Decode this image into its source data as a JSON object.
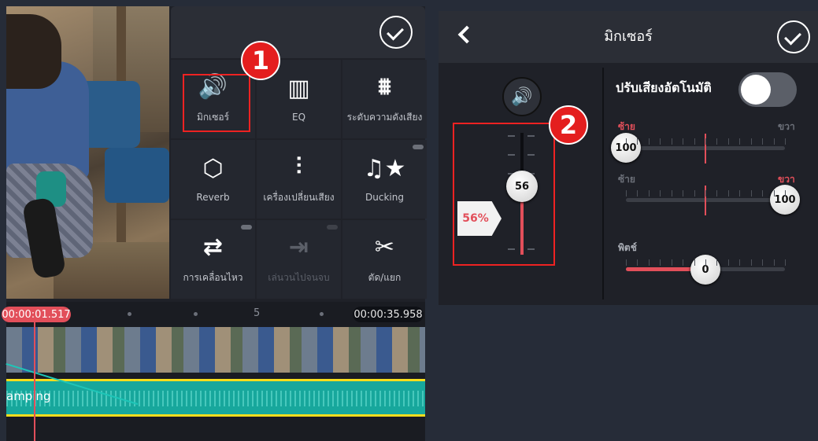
{
  "editor": {
    "tools": [
      {
        "id": "mixer",
        "label": "มิกเซอร์",
        "icon": "speaker-icon",
        "glyph": "🔊"
      },
      {
        "id": "eq",
        "label": "EQ",
        "icon": "equalizer-icon",
        "glyph": "▥"
      },
      {
        "id": "loudness",
        "label": "ระดับความดังเสียง",
        "icon": "loudness-icon",
        "glyph": "⩩"
      },
      {
        "id": "reverb",
        "label": "Reverb",
        "icon": "cube-icon",
        "glyph": "⬡"
      },
      {
        "id": "voice-changer",
        "label": "เครื่องเปลี่ยนเสียง",
        "icon": "waveform-icon",
        "glyph": "⫶"
      },
      {
        "id": "ducking",
        "label": "Ducking",
        "icon": "music-star-icon",
        "glyph": "♫★"
      },
      {
        "id": "motion",
        "label": "การเคลื่อนไหว",
        "icon": "loop-icon",
        "glyph": "⇄"
      },
      {
        "id": "loop",
        "label": "เล่นวนไปจนจบ",
        "icon": "loop-to-end-icon",
        "glyph": "⇥"
      },
      {
        "id": "cut",
        "label": "ตัด/แยก",
        "icon": "scissors-icon",
        "glyph": "✂"
      }
    ],
    "badge1": "1",
    "timeline": {
      "current_time": "00:00:01.517",
      "total_time": "00:00:35.958",
      "marker": "5",
      "audio_label": "amping"
    }
  },
  "mixer": {
    "title": "มิกเซอร์",
    "badge2": "2",
    "volume": {
      "percent_label": "56%",
      "value": 56,
      "fraction": 0.56
    },
    "auto_volume_label": "ปรับเสียงอัตโนมัติ",
    "auto_volume_on": false,
    "pan_left": {
      "left_label": "ซ้าย",
      "right_label": "ขวา",
      "value": 100,
      "fraction": 0.0
    },
    "pan_right": {
      "left_label": "ซ้าย",
      "right_label": "ขวา",
      "value": 100,
      "fraction": 1.0
    },
    "pitch": {
      "label": "พิตช์",
      "value": 0,
      "fraction": 0.5
    }
  },
  "colors": {
    "accent": "#e24f5a",
    "highlight": "#ee2222",
    "audio": "#17a79c"
  }
}
